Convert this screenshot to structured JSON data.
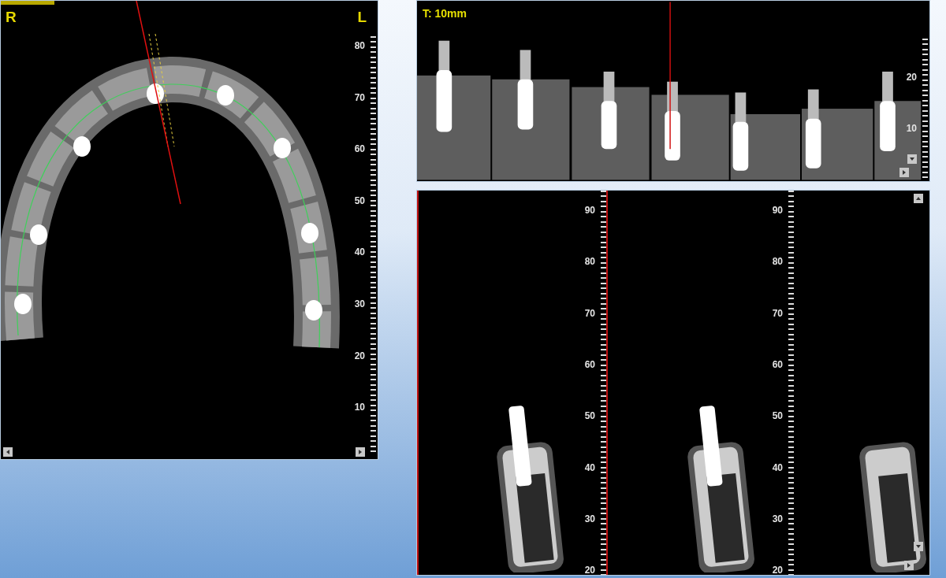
{
  "axial_view": {
    "left_label": "R",
    "right_label": "L",
    "ruler_ticks": [
      "80",
      "70",
      "60",
      "50",
      "40",
      "30",
      "20",
      "10"
    ]
  },
  "panoramic_view": {
    "thickness_label": "T: 10mm",
    "ruler_ticks": [
      "20",
      "10"
    ]
  },
  "cross_section_view": {
    "slices": [
      {
        "selected": true,
        "ruler_ticks": [
          "90",
          "80",
          "70",
          "60",
          "50",
          "40",
          "30",
          "20"
        ]
      },
      {
        "selected": false,
        "ruler_ticks": [
          "90",
          "80",
          "70",
          "60",
          "50",
          "40",
          "30",
          "20"
        ]
      },
      {
        "selected": false
      }
    ]
  }
}
